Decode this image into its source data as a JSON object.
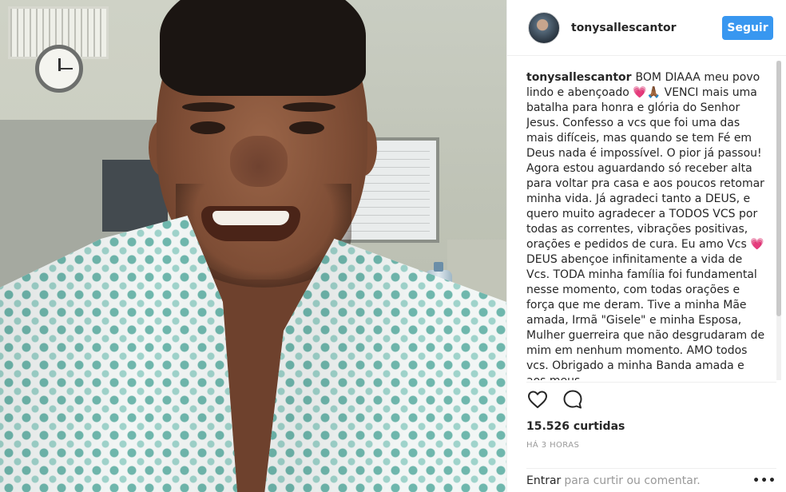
{
  "post": {
    "username": "tonysallescantor",
    "follow_label": "Seguir",
    "caption_user": "tonysallescantor",
    "caption_text": "BOM DIAAA meu povo lindo e abençoado 💗🙏🏾 VENCI mais uma batalha para honra e glória do Senhor Jesus. Confesso a vcs que foi uma das mais difíceis, mas quando se tem Fé em Deus nada é impossível. O pior já passou! Agora estou aguardando só receber alta para voltar pra casa e aos poucos retomar minha vida. Já agradeci tanto a DEUS, e quero muito agradecer a TODOS VCS por todas as correntes, vibrações positivas, orações e pedidos de cura. Eu amo Vcs 💗 DEUS abençoe infinitamente a vida de Vcs. TODA minha família foi fundamental nesse momento, com todas orações e força que me deram. Tive a minha Mãe amada, Irmã \"Gisele\" e minha Esposa, Mulher guerreira que não desgrudaram de mim em nenhum momento. AMO todos vcs. Obrigado a minha Banda amada e aos meus",
    "likes": "15.526 curtidas",
    "time": "HÁ 3 HORAS",
    "comment_login": "Entrar",
    "comment_placeholder": "para curtir ou comentar.",
    "more_options": "•••"
  },
  "icons": {
    "like": "heart-outline-icon",
    "comment": "speech-bubble-icon"
  },
  "colors": {
    "follow_button": "#3897f0",
    "text": "#262626",
    "muted": "#999999"
  }
}
